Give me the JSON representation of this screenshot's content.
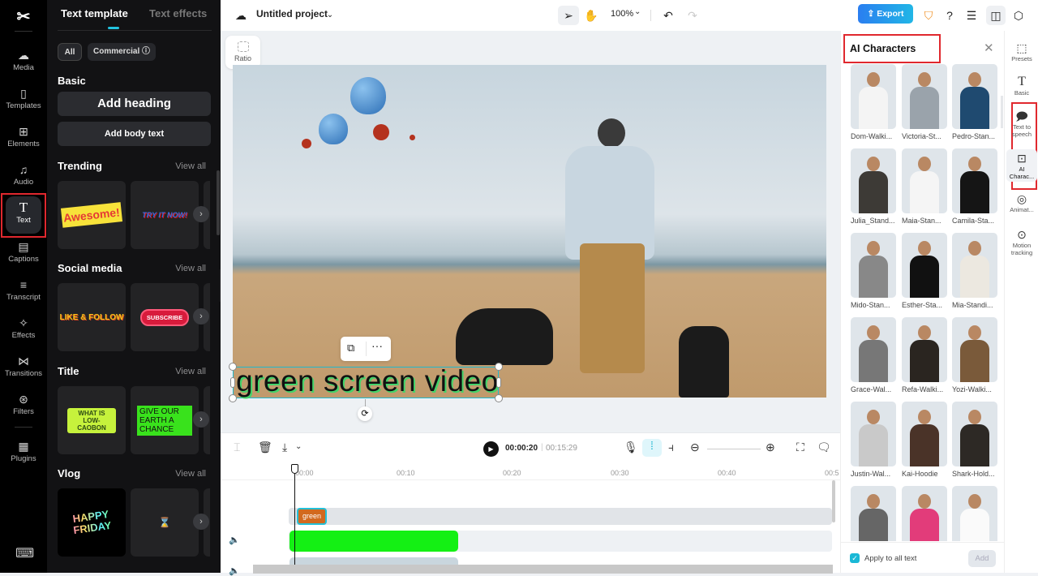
{
  "rail": {
    "logo": "✂",
    "items": [
      {
        "label": "Media",
        "icon": "☁"
      },
      {
        "label": "Templates",
        "icon": "▯"
      },
      {
        "label": "Elements",
        "icon": "⊞"
      },
      {
        "label": "Audio",
        "icon": "♫"
      },
      {
        "label": "Text",
        "icon": "T"
      },
      {
        "label": "Captions",
        "icon": "▤"
      },
      {
        "label": "Transcript",
        "icon": "≡"
      },
      {
        "label": "Effects",
        "icon": "✧"
      },
      {
        "label": "Transitions",
        "icon": "⋈"
      },
      {
        "label": "Filters",
        "icon": "⊛"
      },
      {
        "label": "Plugins",
        "icon": "▦"
      }
    ],
    "keyboard_icon": "⌨"
  },
  "panel": {
    "tabs": [
      "Text template",
      "Text effects"
    ],
    "chips": [
      "All",
      "Commercial ⓘ"
    ],
    "basic_title": "Basic",
    "add_heading": "Add heading",
    "add_body": "Add body text",
    "view_all": "View all",
    "sections": [
      {
        "title": "Trending",
        "cards": [
          "Awesome!",
          "TRY IT NOW!"
        ]
      },
      {
        "title": "Social media",
        "cards": [
          "LIKE & FOLLOW",
          "SUBSCRIBE"
        ]
      },
      {
        "title": "Title",
        "cards": [
          "WHAT IS LOW-CAOBON",
          "GIVE OUR EARTH A CHANCE"
        ]
      },
      {
        "title": "Vlog",
        "cards": [
          "HAPPY FRIDAY",
          "⌛"
        ]
      }
    ]
  },
  "topbar": {
    "project_name": "Untitled project",
    "zoom": "100%",
    "export_label": "Export",
    "colors": {
      "export": "#2a8ef0",
      "shield": "#f08c1c"
    }
  },
  "stage": {
    "ratio_label": "Ratio",
    "overlay_text": "green screen video"
  },
  "timeline": {
    "current_time": "00:00:20",
    "total_time": "00:15:29",
    "ticks": [
      "00:00",
      "00:10",
      "00:20",
      "00:30",
      "00:40",
      "00:5"
    ],
    "text_clip_label": "green"
  },
  "ai_panel": {
    "title": "AI Characters",
    "characters": [
      "Dom-Walki...",
      "Victoria-St...",
      "Pedro-Stan...",
      "Julia_Stand...",
      "Maia-Stan...",
      "Camila-Sta...",
      "Mido-Stan...",
      "Esther-Sta...",
      "Mia-Standi...",
      "Grace-Wal...",
      "Refa-Walki...",
      "Yozi-Walki...",
      "Justin-Wal...",
      "Kai-Hoodie",
      "Shark-Hold...",
      "",
      "",
      ""
    ],
    "apply_all_label": "Apply to all text",
    "apply_all_checked": true,
    "add_label": "Add"
  },
  "right_rail": {
    "items": [
      {
        "label": "Presets",
        "icon": "⬚"
      },
      {
        "label": "Basic",
        "icon": "T"
      },
      {
        "label": "Text to speech",
        "icon": "🗩"
      },
      {
        "label": "AI Charac...",
        "icon": "⊡"
      },
      {
        "label": "Animat...",
        "icon": "◎"
      },
      {
        "label": "Motion tracking",
        "icon": "⊙"
      }
    ]
  }
}
